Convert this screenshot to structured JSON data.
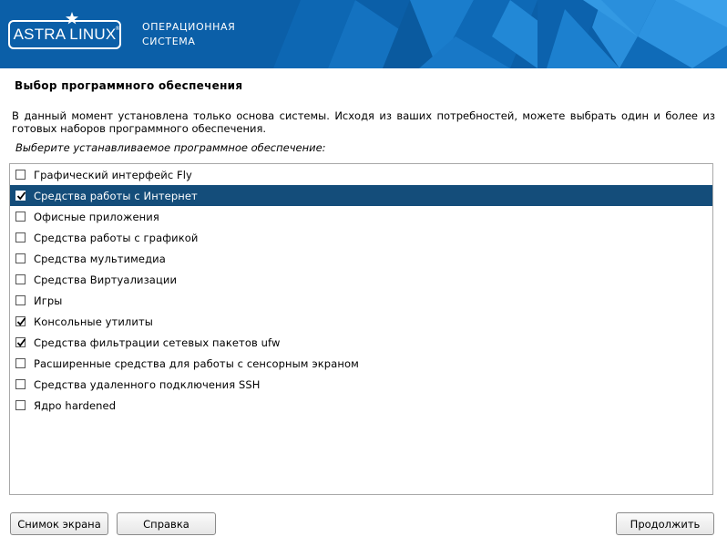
{
  "banner": {
    "logo_text": "ASTRA LINUX",
    "logo_reg": "®",
    "subtitle_line1": "ОПЕРАЦИОННАЯ",
    "subtitle_line2": "СИСТЕМА"
  },
  "page": {
    "title": "Выбор программного обеспечения",
    "description": "В данный момент установлена только основа системы. Исходя из ваших потребностей, можете выбрать один и более из готовых наборов программного обеспечения.",
    "prompt": "Выберите устанавливаемое программное обеспечение:"
  },
  "software_list": {
    "items": [
      {
        "label": "Графический интерфейс Fly",
        "checked": false,
        "selected": false
      },
      {
        "label": "Средства работы с Интернет",
        "checked": true,
        "selected": true
      },
      {
        "label": "Офисные приложения",
        "checked": false,
        "selected": false
      },
      {
        "label": "Средства работы с графикой",
        "checked": false,
        "selected": false
      },
      {
        "label": "Средства мультимедиа",
        "checked": false,
        "selected": false
      },
      {
        "label": "Средства Виртуализации",
        "checked": false,
        "selected": false
      },
      {
        "label": "Игры",
        "checked": false,
        "selected": false
      },
      {
        "label": "Консольные утилиты",
        "checked": true,
        "selected": false
      },
      {
        "label": "Средства фильтрации сетевых пакетов ufw",
        "checked": true,
        "selected": false
      },
      {
        "label": "Расширенные средства для работы с сенсорным экраном",
        "checked": false,
        "selected": false
      },
      {
        "label": "Средства удаленного подключения SSH",
        "checked": false,
        "selected": false
      },
      {
        "label": "Ядро hardened",
        "checked": false,
        "selected": false
      }
    ]
  },
  "buttons": {
    "screenshot": "Снимок экрана",
    "help": "Справка",
    "continue": "Продолжить"
  },
  "colors": {
    "banner_blue": "#0b5fa8",
    "selection_blue": "#144d7a"
  }
}
